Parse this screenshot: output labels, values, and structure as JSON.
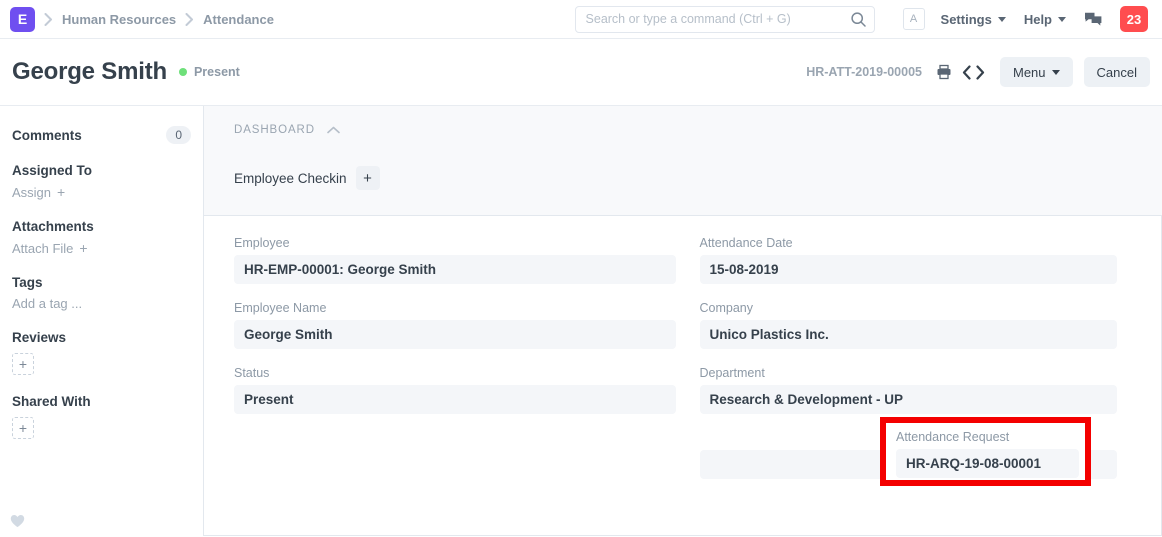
{
  "navbar": {
    "logo_letter": "E",
    "breadcrumbs": [
      {
        "label": "Human Resources"
      },
      {
        "label": "Attendance"
      }
    ],
    "search": {
      "placeholder": "Search or type a command (Ctrl + G)",
      "value": ""
    },
    "avatar_letter": "A",
    "settings_label": "Settings",
    "help_label": "Help",
    "notification_count": "23",
    "badge_color": "#ff4d4f",
    "logo_color": "#6f4ff0"
  },
  "titlebar": {
    "title": "George Smith",
    "status": "Present",
    "status_color": "#6ee07a",
    "doc_name": "HR-ATT-2019-00005",
    "menu_label": "Menu",
    "cancel_label": "Cancel"
  },
  "sidebar": {
    "comments": {
      "label": "Comments",
      "count": "0"
    },
    "assigned_to": {
      "label": "Assigned To",
      "action": "Assign",
      "plus": "+"
    },
    "attachments": {
      "label": "Attachments",
      "action": "Attach File",
      "plus": "+"
    },
    "tags": {
      "label": "Tags",
      "action": "Add a tag ..."
    },
    "reviews": {
      "label": "Reviews",
      "plus": "+"
    },
    "shared_with": {
      "label": "Shared With",
      "plus": "+"
    }
  },
  "dashboard": {
    "section_title": "DASHBOARD",
    "checkin_label": "Employee Checkin",
    "checkin_plus": "+"
  },
  "form": {
    "left": [
      {
        "label": "Employee",
        "value": "HR-EMP-00001: George Smith"
      },
      {
        "label": "Employee Name",
        "value": "George Smith"
      },
      {
        "label": "Status",
        "value": "Present"
      }
    ],
    "right": [
      {
        "label": "Attendance Date",
        "value": "15-08-2019"
      },
      {
        "label": "Company",
        "value": "Unico Plastics Inc."
      },
      {
        "label": "Department",
        "value": "Research & Development - UP"
      }
    ],
    "highlighted": {
      "label": "Attendance Request",
      "value": "HR-ARQ-19-08-00001",
      "highlight_color": "#f40000"
    }
  }
}
